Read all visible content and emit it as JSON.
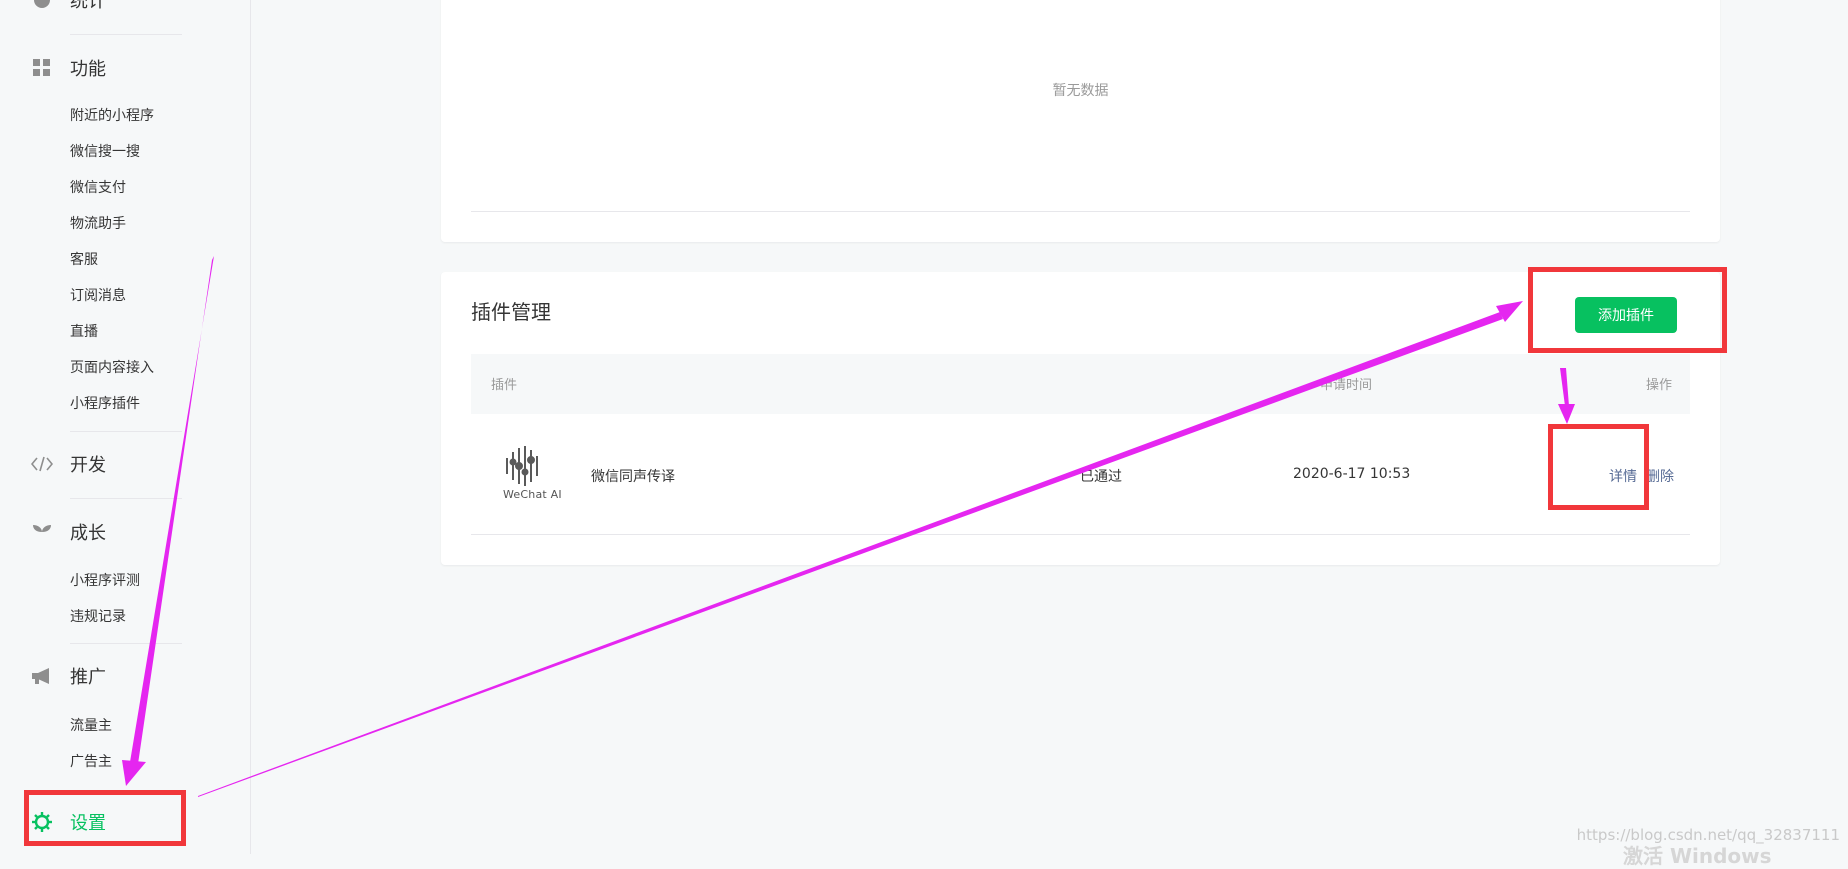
{
  "sidebar": {
    "stats_label": "统计",
    "function_label": "功能",
    "function_items": [
      "附近的小程序",
      "微信搜一搜",
      "微信支付",
      "物流助手",
      "客服",
      "订阅消息",
      "直播",
      "页面内容接入",
      "小程序插件"
    ],
    "develop_label": "开发",
    "growth_label": "成长",
    "growth_items": [
      "小程序评测",
      "违规记录"
    ],
    "promote_label": "推广",
    "promote_items": [
      "流量主",
      "广告主"
    ],
    "settings_label": "设置"
  },
  "top_panel": {
    "empty_text": "暂无数据"
  },
  "plugins": {
    "title": "插件管理",
    "add_button": "添加插件",
    "headers": {
      "plugin": "插件",
      "time": "申请时间",
      "action": "操作"
    },
    "rows": [
      {
        "logo_text": "WeChat AI",
        "name": "微信同声传译",
        "status": "已通过",
        "time": "2020-6-17 10:53",
        "detail": "详情",
        "delete": "删除"
      }
    ]
  },
  "watermark": "https://blog.csdn.net/qq_32837111",
  "watermark_windows": "激活 Windows",
  "colors": {
    "accent_green": "#07c160",
    "link": "#576b95",
    "annotation_red": "#f1373b",
    "arrow_magenta": "#e526f0"
  }
}
